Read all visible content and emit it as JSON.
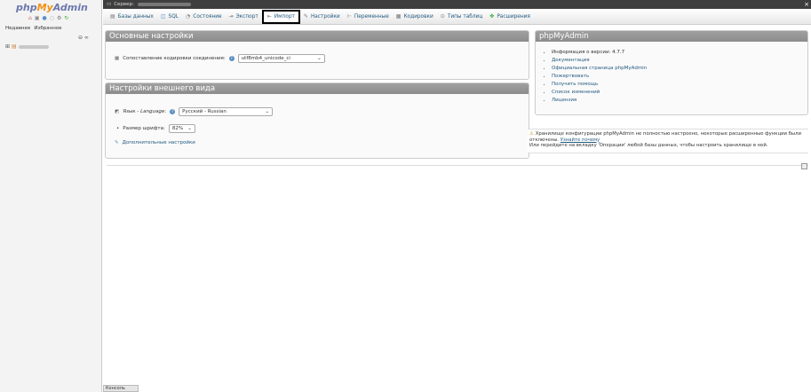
{
  "logo": {
    "php": "php",
    "my": "My",
    "admin": "Admin"
  },
  "sidebar": {
    "tab_recent": "Недавнее",
    "tab_favorites": "Избранное",
    "collapse": "⊖ ∞"
  },
  "topbar": {
    "server_label": "Сервер:"
  },
  "tabs": [
    {
      "label": "Базы данных",
      "icon": "database-icon"
    },
    {
      "label": "SQL",
      "icon": "sql-icon"
    },
    {
      "label": "Состояние",
      "icon": "status-icon"
    },
    {
      "label": "Экспорт",
      "icon": "export-icon"
    },
    {
      "label": "Импорт",
      "icon": "import-icon"
    },
    {
      "label": "Настройки",
      "icon": "wrench-icon"
    },
    {
      "label": "Переменные",
      "icon": "variables-icon"
    },
    {
      "label": "Кодировки",
      "icon": "charset-icon"
    },
    {
      "label": "Типы таблиц",
      "icon": "engines-icon"
    },
    {
      "label": "Расширения",
      "icon": "plugins-icon"
    }
  ],
  "general": {
    "title": "Основные настройки",
    "collation_label": "Сопоставление кодировки соединения:",
    "collation_value": "utf8mb4_unicode_ci"
  },
  "appearance": {
    "title": "Настройки внешнего вида",
    "language_label": "Язык - ",
    "language_label_italic": "Language",
    "language_value": "Русский - Russian",
    "fontsize_label": "Размер шрифта:",
    "fontsize_value": "82%",
    "more_settings": "Дополнительные настройки"
  },
  "info": {
    "title": "phpMyAdmin",
    "items": [
      "Информация о версии: 4.7.7",
      "Документация",
      "Официальная страница phpMyAdmin",
      "Пожертвовать",
      "Получить помощь",
      "Список изменений",
      "Лицензия"
    ]
  },
  "notice": {
    "text1": "Хранилище конфигурации phpMyAdmin не полностью настроено, некоторые расширенные функции были отключены.",
    "link": "Узнайте почему",
    "text2": "Или перейдите на вкладку 'Операции' любой базы данных, чтобы настроить хранилище в ней."
  },
  "console": {
    "label": "Консоль"
  }
}
